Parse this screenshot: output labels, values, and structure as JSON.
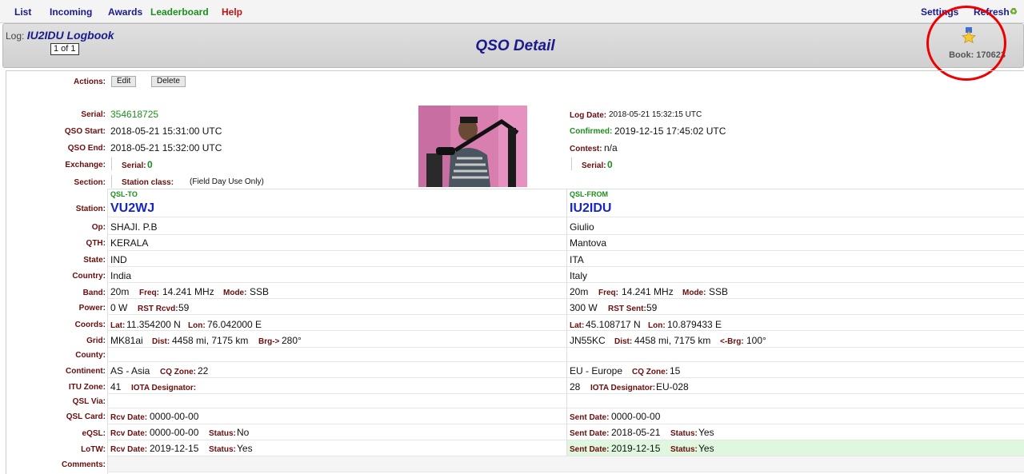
{
  "nav": {
    "list": "List",
    "incoming": "Incoming",
    "awards": "Awards",
    "leaderboard": "Leaderboard",
    "help": "Help",
    "settings": "Settings",
    "refresh": "Refresh"
  },
  "header": {
    "log_prefix": "Log:",
    "log_name": "IU2IDU Logbook",
    "pager": "1 of 1",
    "title": "QSO Detail",
    "book": "Book: 170623"
  },
  "actions": {
    "label": "Actions:",
    "edit": "Edit",
    "delete": "Delete"
  },
  "qso": {
    "serial_label": "Serial:",
    "serial": "354618725",
    "start_label": "QSO Start:",
    "start": "2018-05-21 15:31:00 UTC",
    "end_label": "QSO End:",
    "end": "2018-05-21 15:32:00 UTC",
    "exchange_label": "Exchange:",
    "exchange_serial_label": "Serial:",
    "exchange_serial": "0",
    "section_label": "Section:",
    "station_class_label": "Station class:",
    "station_class_note": "(Field Day Use Only)",
    "log_date_label": "Log Date:",
    "log_date": "2018-05-21 15:32:15 UTC",
    "confirmed_label": "Confirmed:",
    "confirmed": "2019-12-15 17:45:02 UTC",
    "contest_label": "Contest:",
    "contest": "n/a",
    "right_serial_label": "Serial:",
    "right_serial": "0"
  },
  "table": {
    "qsl_to": "QSL-TO",
    "qsl_from": "QSL-FROM",
    "labels": {
      "station": "Station:",
      "op": "Op:",
      "qth": "QTH:",
      "state": "State:",
      "country": "Country:",
      "band": "Band:",
      "power": "Power:",
      "coords": "Coords:",
      "grid": "Grid:",
      "county": "County:",
      "continent": "Continent:",
      "itu": "ITU Zone:",
      "qsl_via": "QSL Via:",
      "qsl_card": "QSL Card:",
      "eqsl": "eQSL:",
      "lotw": "LoTW:",
      "comments": "Comments:"
    },
    "sub": {
      "freq": "Freq:",
      "mode": "Mode:",
      "rst_rcvd": "RST Rcvd:",
      "rst_sent": "RST Sent:",
      "lat": "Lat:",
      "lon": "Lon:",
      "dist": "Dist:",
      "brg_to": "Brg->",
      "brg_from": "<-Brg:",
      "cq_zone": "CQ Zone:",
      "iota": "IOTA Designator:",
      "rcv_date": "Rcv Date:",
      "sent_date": "Sent Date:",
      "status": "Status:"
    },
    "to": {
      "station": "VU2WJ",
      "op": "SHAJI. P.B",
      "qth": "KERALA",
      "state": "IND",
      "country": "India",
      "band": "20m",
      "freq": "14.241 MHz",
      "mode": "SSB",
      "power": "0 W",
      "rst": "59",
      "lat": "11.354200 N",
      "lon": "76.042000 E",
      "grid": "MK81ai",
      "dist": "4458 mi, 7175 km",
      "brg": "280°",
      "continent": "AS - Asia",
      "cq_zone": "22",
      "itu": "41",
      "qsl_card_date": "0000-00-00",
      "eqsl_date": "0000-00-00",
      "eqsl_status": "No",
      "lotw_date": "2019-12-15",
      "lotw_status": "Yes"
    },
    "from": {
      "station": "IU2IDU",
      "op": "Giulio",
      "qth": "Mantova",
      "state": "ITA",
      "country": "Italy",
      "band": "20m",
      "freq": "14.241 MHz",
      "mode": "SSB",
      "power": "300 W",
      "rst": "59",
      "lat": "45.108717 N",
      "lon": "10.879433 E",
      "grid": "JN55KC",
      "dist": "4458 mi, 7175 km",
      "brg": "100°",
      "continent": "EU - Europe",
      "cq_zone": "15",
      "itu": "28",
      "iota": "EU-028",
      "qsl_card_date": "0000-00-00",
      "eqsl_date": "2018-05-21",
      "eqsl_status": "Yes",
      "lotw_date": "2019-12-15",
      "lotw_status": "Yes"
    }
  },
  "colors": {
    "nav_blue": "#1a1a8c",
    "leaderboard_green": "#1b8f1b",
    "help_red": "#c21212",
    "label_red": "#6b0d0d",
    "call_blue": "#1626c4"
  }
}
